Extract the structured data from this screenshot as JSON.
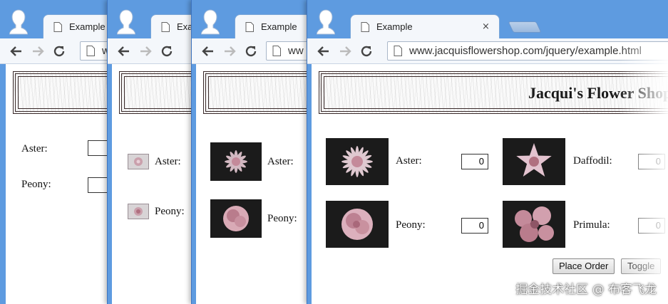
{
  "browser": {
    "tab_title": "Example",
    "tab_close": "×",
    "url": "www.jacquisflowershop.com/jquery/example.html",
    "url_truncated": "ww",
    "icons": [
      "profile-icon",
      "page-icon",
      "back-arrow-icon",
      "forward-arrow-icon",
      "reload-icon",
      "new-tab-icon"
    ]
  },
  "page": {
    "title": "Jacqui's Flower Shop",
    "flowers": [
      {
        "name": "Aster:",
        "qty": "0",
        "icon": "aster-flower-image"
      },
      {
        "name": "Daffodil:",
        "qty": "0",
        "icon": "daffodil-flower-image"
      },
      {
        "name": "Peony:",
        "qty": "0",
        "icon": "peony-flower-image"
      },
      {
        "name": "Primula:",
        "qty": "0",
        "icon": "primula-flower-image"
      }
    ],
    "buttons": {
      "place_order": "Place Order",
      "toggle": "Toggle"
    }
  },
  "watermark": "掘金技术社区 @ 布客飞龙",
  "colors": {
    "chrome_frame": "#5e9be0",
    "toolbar": "#f4f7fb",
    "header_border": "#3a2a2a",
    "thumb_bg": "#1b1b1b",
    "flower_pink": "#c48a9a"
  }
}
